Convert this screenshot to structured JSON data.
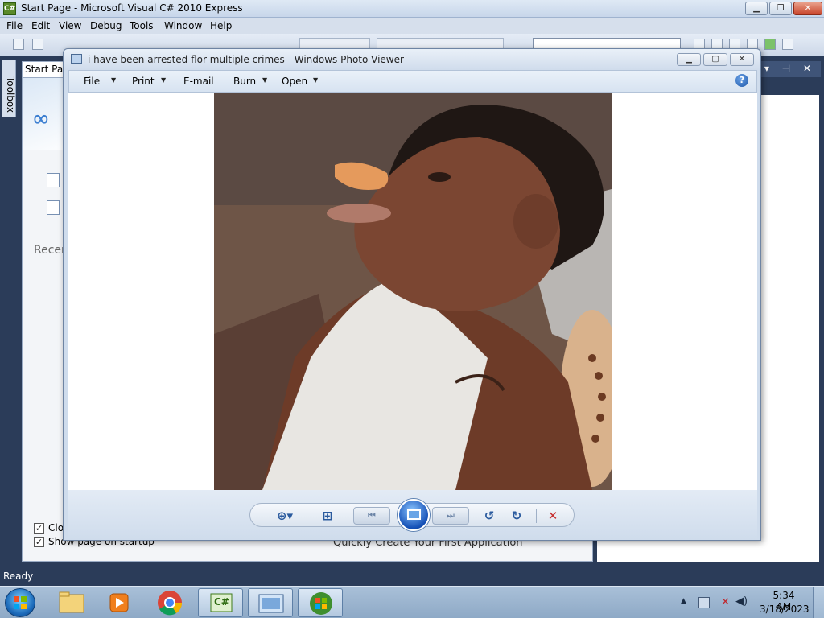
{
  "vs": {
    "title": "Start Page - Microsoft Visual C# 2010 Express",
    "app_icon": "C#",
    "menu": [
      "File",
      "Edit",
      "View",
      "Debug",
      "Tools",
      "Window",
      "Help"
    ],
    "toolbox_label": "Toolbox",
    "startpage_tab": "Start Page",
    "recent_label": "Recen",
    "close_page_label": "Clo",
    "show_on_startup_label": "Show page on startup",
    "quick_create_label": "Quickly Create Your First Application",
    "right_panel_controls": "▾ ⊣ ✕",
    "status": "Ready"
  },
  "photo_viewer": {
    "title": "i have been arrested flor multiple crimes - Windows Photo Viewer",
    "menu": {
      "file": "File",
      "print": "Print",
      "email": "E-mail",
      "burn": "Burn",
      "open": "Open"
    },
    "help": "?",
    "controls": {
      "zoom": "⊕▾",
      "fit": "⊞",
      "prev": "⏮",
      "next": "⏭",
      "rotate_ccw": "↺",
      "rotate_cw": "↻",
      "delete": "✕"
    }
  },
  "taskbar": {
    "items": [
      "explorer-icon",
      "media-player-icon",
      "chrome-icon",
      "visual-csharp-icon",
      "photo-viewer-icon",
      "windows-update-icon"
    ],
    "csharp_label": "C#",
    "time": "5:34 AM",
    "date": "3/18/2023"
  },
  "colors": {
    "vs_frame": "#2b3c59",
    "photo_viewer_frame": "#cfdcec",
    "delete_red": "#c62f2f",
    "start_orb": "#1a68b8"
  }
}
